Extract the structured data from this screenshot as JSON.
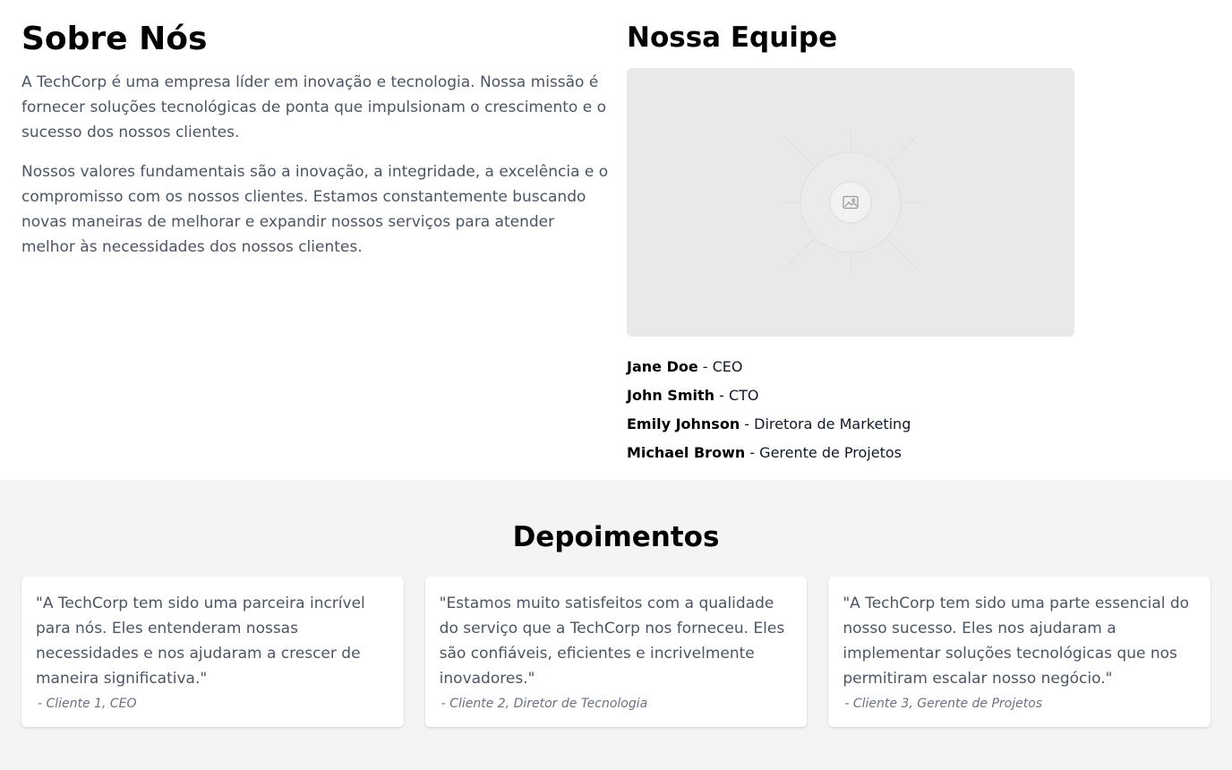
{
  "about": {
    "title": "Sobre Nós",
    "paragraphs": [
      "A TechCorp é uma empresa líder em inovação e tecnologia. Nossa missão é fornecer soluções tecnológicas de ponta que impulsionam o crescimento e o sucesso dos nossos clientes.",
      "Nossos valores fundamentais são a inovação, a integridade, a excelência e o compromisso com os nossos clientes. Estamos constantemente buscando novas maneiras de melhorar e expandir nossos serviços para atender melhor às necessidades dos nossos clientes."
    ]
  },
  "team": {
    "title": "Nossa Equipe",
    "photo_icon": "image-placeholder-icon",
    "members": [
      {
        "name": "Jane Doe",
        "role": " - CEO"
      },
      {
        "name": "John Smith",
        "role": " - CTO"
      },
      {
        "name": "Emily Johnson",
        "role": " - Diretora de Marketing"
      },
      {
        "name": "Michael Brown",
        "role": " - Gerente de Projetos"
      }
    ]
  },
  "testimonials": {
    "title": "Depoimentos",
    "items": [
      {
        "quote": "\"A TechCorp tem sido uma parceira incrível para nós. Eles entenderam nossas necessidades e nos ajudaram a crescer de maneira significativa.\"",
        "author": "- Cliente 1, CEO"
      },
      {
        "quote": "\"Estamos muito satisfeitos com a qualidade do serviço que a TechCorp nos forneceu. Eles são confiáveis, eficientes e incrivelmente inovadores.\"",
        "author": "- Cliente 2, Diretor de Tecnologia"
      },
      {
        "quote": "\"A TechCorp tem sido uma parte essencial do nosso sucesso. Eles nos ajudaram a implementar soluções tecnológicas que nos permitiram escalar nosso negócio.\"",
        "author": "- Cliente 3, Gerente de Projetos"
      }
    ]
  },
  "colors": {
    "page_background": "#ffffff",
    "section_background": "#f3f4f6",
    "body_text": "#4b5563",
    "muted_text": "#6b7280",
    "placeholder_background": "#e9e9e9"
  }
}
